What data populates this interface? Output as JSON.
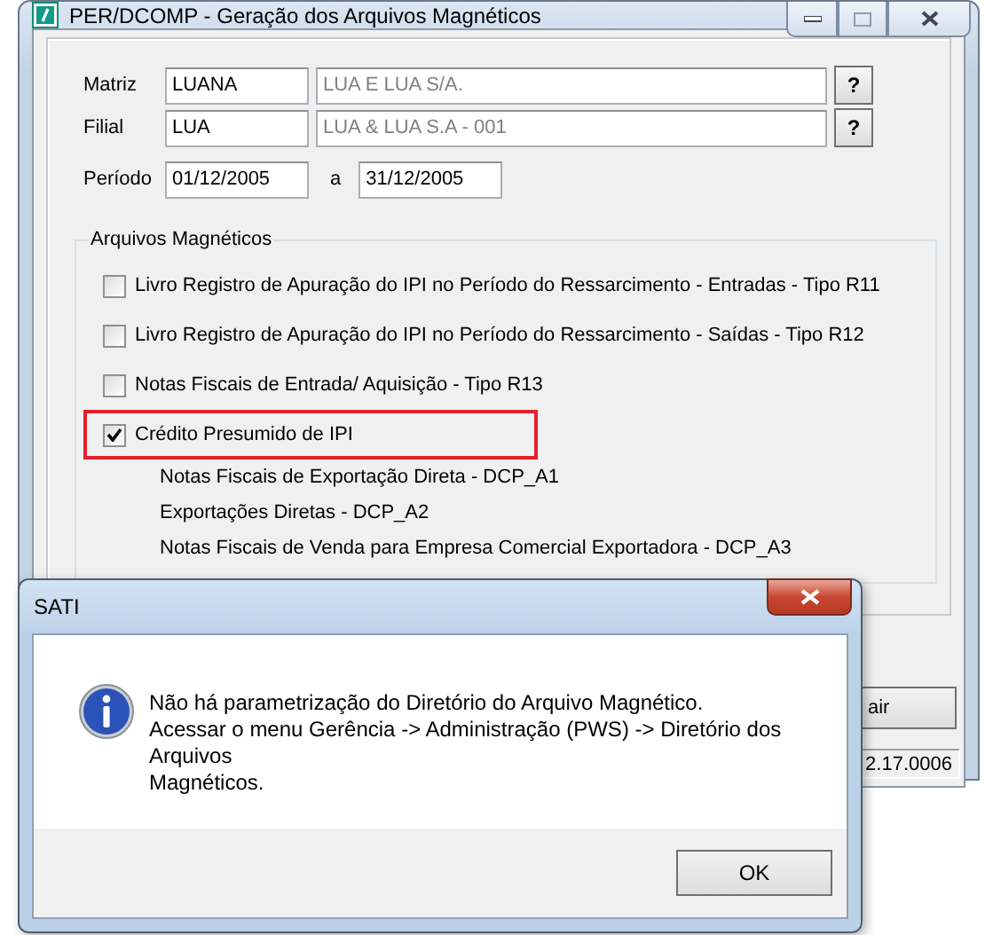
{
  "window": {
    "title": "PER/DCOMP - Geração dos Arquivos Magnéticos"
  },
  "fields": [
    {
      "label": "Matriz",
      "code": "LUANA",
      "name": "LUA E LUA S/A.",
      "lookup": "?"
    },
    {
      "label": "Filial",
      "code": "LUA",
      "name": "LUA & LUA S.A - 001",
      "lookup": "?"
    }
  ],
  "period": {
    "label": "Período",
    "from": "01/12/2005",
    "separator": "a",
    "to": "31/12/2005"
  },
  "group": {
    "title": "Arquivos Magnéticos",
    "items": [
      {
        "label": "Livro Registro de Apuração do IPI no Período do Ressarcimento - Entradas - Tipo R11",
        "checked": false,
        "highlighted": false
      },
      {
        "label": "Livro Registro de Apuração do IPI no Período do Ressarcimento - Saídas - Tipo R12",
        "checked": false,
        "highlighted": false
      },
      {
        "label": "Notas Fiscais de Entrada/ Aquisição - Tipo R13",
        "checked": false,
        "highlighted": false
      },
      {
        "label": "Crédito Presumido de IPI",
        "checked": true,
        "highlighted": true,
        "children": [
          {
            "label": "Notas Fiscais de Exportação Direta - DCP_A1"
          },
          {
            "label": "Exportações Diretas - DCP_A2"
          },
          {
            "label": "Notas Fiscais de Venda para Empresa Comercial Exportadora - DCP_A3"
          }
        ]
      }
    ]
  },
  "exit_button": "air",
  "version": "2.17.0006",
  "dialog": {
    "title": "SATI",
    "message": "Não há parametrização do Diretório do Arquivo Magnético.\nAcessar o menu Gerência -> Administração (PWS) -> Diretório dos\nArquivos\nMagnéticos.",
    "button": "OK"
  }
}
